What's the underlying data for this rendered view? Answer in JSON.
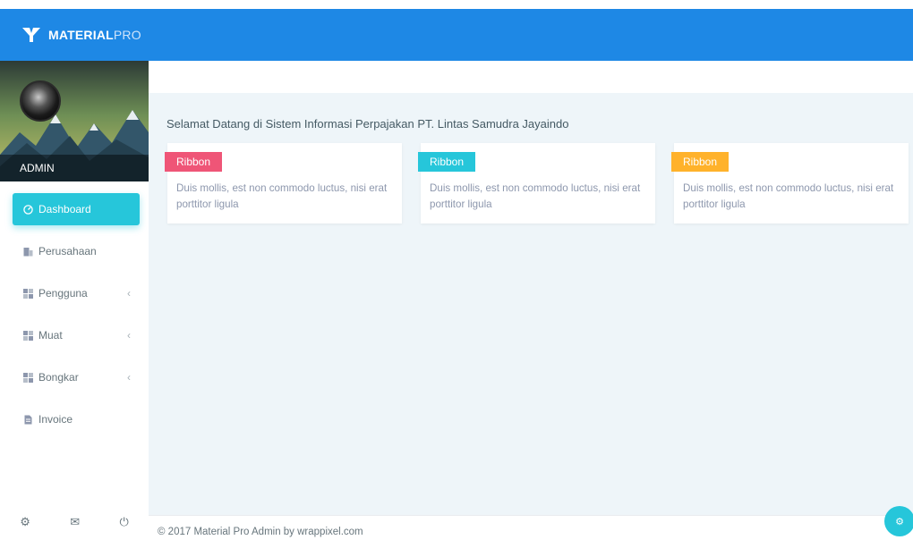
{
  "brand": {
    "bold": "MATERIAL",
    "light": "PRO"
  },
  "profile": {
    "name": "ADMIN"
  },
  "sidebar": {
    "items": [
      {
        "label": "Dashboard",
        "icon": "dashboard-icon",
        "active": true
      },
      {
        "label": "Perusahaan",
        "icon": "building-icon"
      },
      {
        "label": "Pengguna",
        "icon": "grid-icon",
        "chevron": "‹"
      },
      {
        "label": "Muat",
        "icon": "grid-icon",
        "chevron": "‹"
      },
      {
        "label": "Bongkar",
        "icon": "grid-icon",
        "chevron": "‹"
      },
      {
        "label": "Invoice",
        "icon": "document-icon"
      }
    ],
    "footer_icons": {
      "settings": "⚙",
      "mail": "✉",
      "power": "⏻"
    }
  },
  "main": {
    "welcome": "Selamat Datang di Sistem Informasi Perpajakan PT. Lintas Samudra Jayaindo",
    "cards": [
      {
        "ribbon": "Ribbon",
        "ribbon_color": "#ef5577",
        "text": "Duis mollis, est non commodo luctus, nisi erat porttitor ligula"
      },
      {
        "ribbon": "Ribbon",
        "ribbon_color": "#26c6da",
        "text": "Duis mollis, est non commodo luctus, nisi erat porttitor ligula"
      },
      {
        "ribbon": "Ribbon",
        "ribbon_color": "#ffb22b",
        "text": "Duis mollis, est non commodo luctus, nisi erat porttitor ligula"
      }
    ]
  },
  "footer": {
    "text": "© 2017 Material Pro Admin by wrappixel.com"
  },
  "fab": {
    "icon": "⚙"
  },
  "colors": {
    "primary": "#1e88e5",
    "info": "#26c6da",
    "background": "#eef5f9"
  }
}
